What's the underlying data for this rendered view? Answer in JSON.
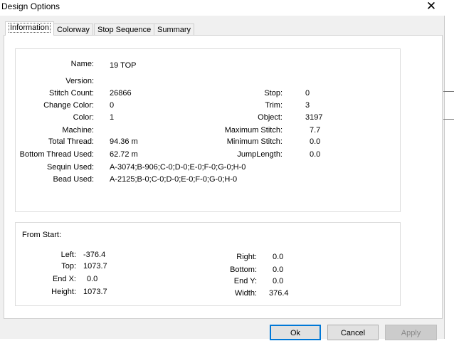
{
  "window": {
    "title": "Design Options",
    "close_glyph": "✕"
  },
  "tabs": [
    {
      "label": "Information",
      "active": true
    },
    {
      "label": "Colorway",
      "active": false
    },
    {
      "label": "Stop Sequence",
      "active": false
    },
    {
      "label": "Summary",
      "active": false
    }
  ],
  "info": {
    "name": {
      "label": "Name:",
      "value": "19 TOP"
    },
    "version": {
      "label": "Version:",
      "value": ""
    },
    "stitch_count": {
      "label": "Stitch Count:",
      "value": "26866"
    },
    "change_color": {
      "label": "Change Color:",
      "value": "0"
    },
    "color": {
      "label": "Color:",
      "value": "1"
    },
    "machine": {
      "label": "Machine:",
      "value": ""
    },
    "total_thread": {
      "label": "Total Thread:",
      "value": "94.36 m"
    },
    "bottom_thread": {
      "label": "Bottom Thread Used:",
      "value": "62.72 m"
    },
    "sequin": {
      "label": "Sequin Used:",
      "value": "A-3074;B-906;C-0;D-0;E-0;F-0;G-0;H-0"
    },
    "bead": {
      "label": "Bead Used:",
      "value": "A-2125;B-0;C-0;D-0;E-0;F-0;G-0;H-0"
    },
    "stop": {
      "label": "Stop:",
      "value": "0"
    },
    "trim": {
      "label": "Trim:",
      "value": "3"
    },
    "object": {
      "label": "Object:",
      "value": "3197"
    },
    "max_stitch": {
      "label": "Maximum Stitch:",
      "value": "7.7"
    },
    "min_stitch": {
      "label": "Minimum Stitch:",
      "value": "0.0"
    },
    "jump_length": {
      "label": "JumpLength:",
      "value": "0.0"
    }
  },
  "start": {
    "heading": "From Start:",
    "left": {
      "label": "Left:",
      "value": "-376.4"
    },
    "top": {
      "label": "Top:",
      "value": "1073.7"
    },
    "end_x": {
      "label": "End X:",
      "value": "0.0"
    },
    "height": {
      "label": "Height:",
      "value": "1073.7"
    },
    "right": {
      "label": "Right:",
      "value": "0.0"
    },
    "bottom": {
      "label": "Bottom:",
      "value": "0.0"
    },
    "end_y": {
      "label": "End Y:",
      "value": "0.0"
    },
    "width": {
      "label": "Width:",
      "value": "376.4"
    }
  },
  "buttons": {
    "ok": "Ok",
    "cancel": "Cancel",
    "apply": "Apply"
  }
}
